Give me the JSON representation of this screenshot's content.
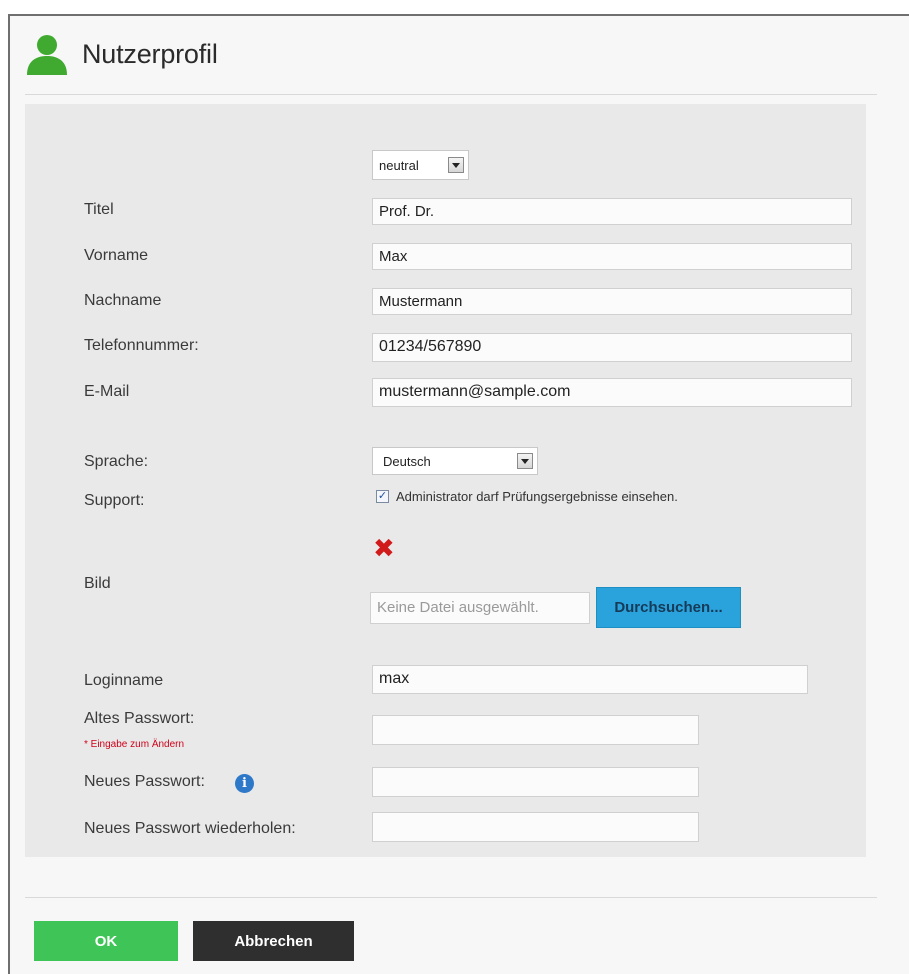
{
  "header": {
    "title": "Nutzerprofil"
  },
  "form": {
    "salutation": {
      "value": "neutral"
    },
    "titel": {
      "label": "Titel",
      "value": "Prof. Dr."
    },
    "vorname": {
      "label": "Vorname",
      "value": "Max"
    },
    "nachname": {
      "label": "Nachname",
      "value": "Mustermann"
    },
    "telefon": {
      "label": "Telefonnummer:",
      "value": "01234/567890"
    },
    "email": {
      "label": "E-Mail",
      "value": "mustermann@sample.com"
    },
    "sprache": {
      "label": "Sprache:",
      "value": "Deutsch"
    },
    "support": {
      "label": "Support:",
      "checkbox_label": "Administrator darf Prüfungsergebnisse einsehen.",
      "checked": true
    },
    "bild": {
      "label": "Bild",
      "file_placeholder": "Keine Datei ausgewählt.",
      "browse_label": "Durchsuchen..."
    },
    "loginname": {
      "label": "Loginname",
      "value": "max"
    },
    "altes_passwort": {
      "label": "Altes Passwort:",
      "hint": "* Eingabe zum Ändern",
      "value": ""
    },
    "neues_passwort": {
      "label": "Neues Passwort:",
      "value": ""
    },
    "neues_passwort_wdh": {
      "label": "Neues Passwort wiederholen:",
      "value": ""
    }
  },
  "footer": {
    "ok_label": "OK",
    "cancel_label": "Abbrechen"
  },
  "colors": {
    "ok": "#3fc557",
    "cancel": "#2f2f2f",
    "browse": "#2aa3dd",
    "user_icon": "#3faa2f",
    "remove_x": "#d11a1a"
  }
}
